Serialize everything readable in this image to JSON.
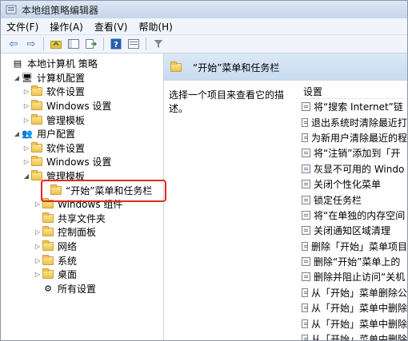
{
  "window": {
    "title": "本地组策略编辑器"
  },
  "menu": [
    "文件(F)",
    "操作(A)",
    "查看(V)",
    "帮助(H)"
  ],
  "tree": [
    {
      "label": "本地计算机 策略",
      "level": 0,
      "toggle": "",
      "icon": "policy-icon"
    },
    {
      "label": "计算机配置",
      "level": 1,
      "toggle": "◢",
      "icon": "computer-icon"
    },
    {
      "label": "软件设置",
      "level": 2,
      "toggle": "▷",
      "icon": "folder-icon"
    },
    {
      "label": "Windows 设置",
      "level": 2,
      "toggle": "▷",
      "icon": "folder-icon"
    },
    {
      "label": "管理模板",
      "level": 2,
      "toggle": "▷",
      "icon": "folder-icon"
    },
    {
      "label": "用户配置",
      "level": 1,
      "toggle": "◢",
      "icon": "user-icon"
    },
    {
      "label": "软件设置",
      "level": 2,
      "toggle": "▷",
      "icon": "folder-icon"
    },
    {
      "label": "Windows 设置",
      "level": 2,
      "toggle": "▷",
      "icon": "folder-icon"
    },
    {
      "label": "管理模板",
      "level": 2,
      "toggle": "◢",
      "icon": "folder-icon"
    },
    {
      "label": "“开始”菜单和任务栏",
      "level": 3,
      "toggle": "",
      "icon": "folder-icon",
      "selected": true
    },
    {
      "label": "Windows 组件",
      "level": 3,
      "toggle": "▷",
      "icon": "folder-icon"
    },
    {
      "label": "共享文件夹",
      "level": 3,
      "toggle": "",
      "icon": "folder-icon"
    },
    {
      "label": "控制面板",
      "level": 3,
      "toggle": "▷",
      "icon": "folder-icon"
    },
    {
      "label": "网络",
      "level": 3,
      "toggle": "▷",
      "icon": "folder-icon"
    },
    {
      "label": "系统",
      "level": 3,
      "toggle": "▷",
      "icon": "folder-icon"
    },
    {
      "label": "桌面",
      "level": 3,
      "toggle": "▷",
      "icon": "folder-icon"
    },
    {
      "label": "所有设置",
      "level": 3,
      "toggle": "",
      "icon": "settings-icon"
    }
  ],
  "right": {
    "header": "“开始”菜单和任务栏",
    "description": "选择一个项目来查看它的描述。",
    "column": "设置",
    "settings": [
      "将“搜索 Internet”链",
      "退出系统时清除最近打",
      "为新用户清除最近的程",
      "将“注销”添加到「开",
      "灰显不可用的 Windo",
      "关闭个性化菜单",
      "锁定任务栏",
      "将“在单独的内存空间",
      "关闭通知区域清理",
      "删除「开始」菜单项目",
      "删除“开始”菜单上的",
      "删除并阻止访问“关机",
      "从「开始」菜单删除公",
      "从「开始」菜单中删除",
      "从「开始」菜单中删除",
      "从「开始」菜单中删除"
    ]
  }
}
